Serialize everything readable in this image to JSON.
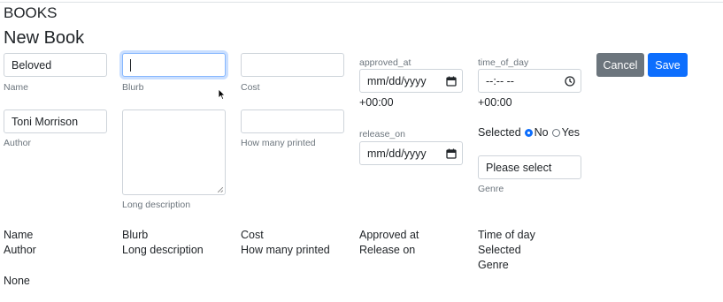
{
  "section_title": "BOOKS",
  "page_title": "New Book",
  "form": {
    "name": {
      "value": "Beloved",
      "label": "Name"
    },
    "blurb": {
      "value": "",
      "label": "Blurb"
    },
    "cost": {
      "value": "",
      "label": "Cost"
    },
    "author": {
      "value": "Toni Morrison",
      "label": "Author"
    },
    "long_description": {
      "value": "",
      "label": "Long description"
    },
    "how_many_printed": {
      "value": "",
      "label": "How many printed"
    },
    "approved_at": {
      "top_label": "approved_at",
      "placeholder": "mm/dd/yyyy",
      "tz": "+00:00"
    },
    "release_on": {
      "top_label": "release_on",
      "placeholder": "mm/dd/yyyy"
    },
    "time_of_day": {
      "top_label": "time_of_day",
      "placeholder": "--:-- --",
      "tz": "+00:00"
    },
    "selected": {
      "label": "Selected",
      "options": [
        "No",
        "Yes"
      ],
      "value": "No"
    },
    "genre": {
      "value": "Please select",
      "label": "Genre"
    }
  },
  "actions": {
    "cancel": "Cancel",
    "save": "Save"
  },
  "summary": {
    "row1": [
      "Name",
      "Blurb",
      "Cost",
      "Approved at",
      "Time of day"
    ],
    "row2": [
      "Author",
      "Long description",
      "How many printed",
      "Release on",
      "Selected"
    ],
    "row3": [
      "Genre"
    ],
    "footer": "None"
  },
  "colors": {
    "primary": "#0d6efd",
    "secondary": "#6c757d",
    "focus_border": "#86b7fe"
  },
  "icons": [
    "calendar-icon",
    "clock-icon",
    "mouse-cursor-icon"
  ]
}
